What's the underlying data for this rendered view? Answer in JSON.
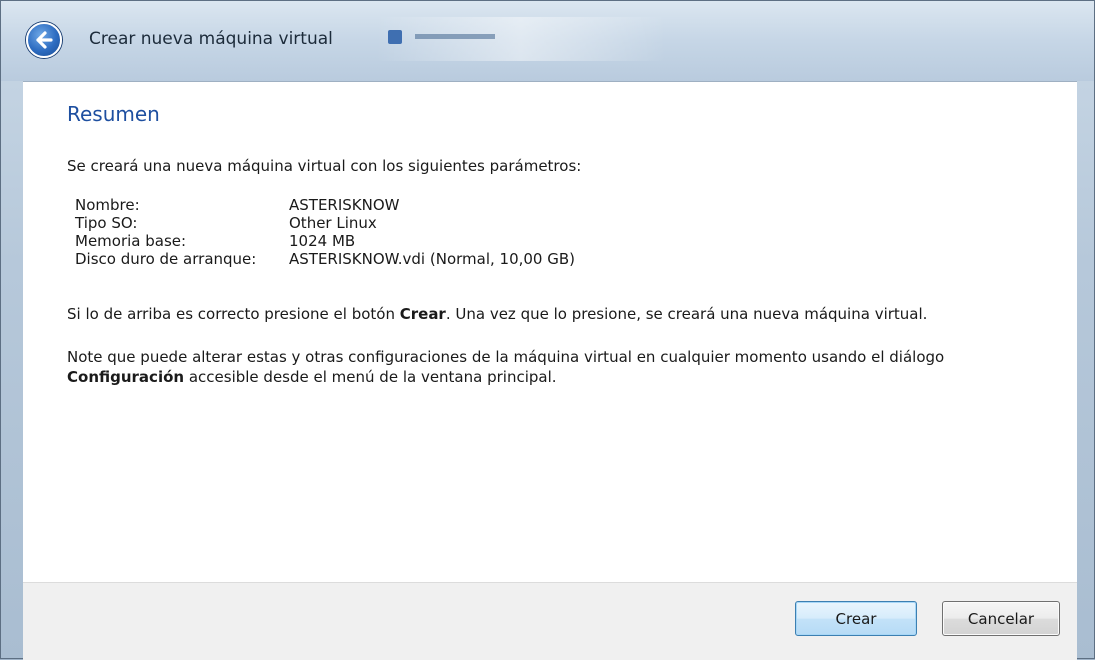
{
  "window": {
    "title": "Crear nueva máquina virtual"
  },
  "icons": {
    "back": "back-arrow-icon"
  },
  "summary": {
    "heading": "Resumen",
    "intro": "Se creará una nueva máquina virtual con los siguientes parámetros:",
    "params": [
      {
        "label": "Nombre:",
        "value": "ASTERISKNOW"
      },
      {
        "label": "Tipo SO:",
        "value": "Other Linux"
      },
      {
        "label": "Memoria base:",
        "value": "1024 MB"
      },
      {
        "label": "Disco duro de arranque:",
        "value": "ASTERISKNOW.vdi (Normal, 10,00 GB)"
      }
    ],
    "confirm_before": "Si lo de arriba es correcto presione el botón ",
    "confirm_bold": "Crear",
    "confirm_after": ". Una vez que lo presione, se creará una nueva máquina virtual.",
    "note_line1": "Note que puede alterar estas y otras configuraciones de la máquina virtual en cualquier momento usando el diálogo",
    "note_bold": "Configuración",
    "note_after": " accesible desde el menú de la ventana principal."
  },
  "footer": {
    "create_label": "Crear",
    "cancel_label": "Cancelar"
  },
  "colors": {
    "heading": "#1e4fa0",
    "primary_button_border": "#3c7fb1"
  }
}
